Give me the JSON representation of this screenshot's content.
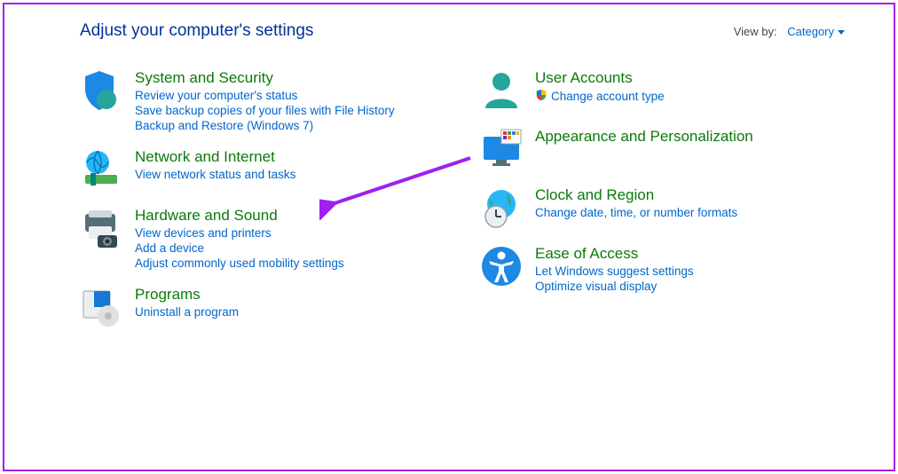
{
  "header": {
    "title": "Adjust your computer's settings",
    "view_by_label": "View by:",
    "view_by_value": "Category"
  },
  "left": [
    {
      "id": "system-security",
      "title": "System and Security",
      "links": [
        "Review your computer's status",
        "Save backup copies of your files with File History",
        "Backup and Restore (Windows 7)"
      ]
    },
    {
      "id": "network-internet",
      "title": "Network and Internet",
      "links": [
        "View network status and tasks"
      ]
    },
    {
      "id": "hardware-sound",
      "title": "Hardware and Sound",
      "links": [
        "View devices and printers",
        "Add a device",
        "Adjust commonly used mobility settings"
      ]
    },
    {
      "id": "programs",
      "title": "Programs",
      "links": [
        "Uninstall a program"
      ]
    }
  ],
  "right": [
    {
      "id": "user-accounts",
      "title": "User Accounts",
      "links": [
        {
          "text": "Change account type",
          "shield": true
        }
      ]
    },
    {
      "id": "appearance-personalization",
      "title": "Appearance and Personalization",
      "links": []
    },
    {
      "id": "clock-region",
      "title": "Clock and Region",
      "links": [
        "Change date, time, or number formats"
      ]
    },
    {
      "id": "ease-of-access",
      "title": "Ease of Access",
      "links": [
        "Let Windows suggest settings",
        "Optimize visual display"
      ]
    }
  ]
}
